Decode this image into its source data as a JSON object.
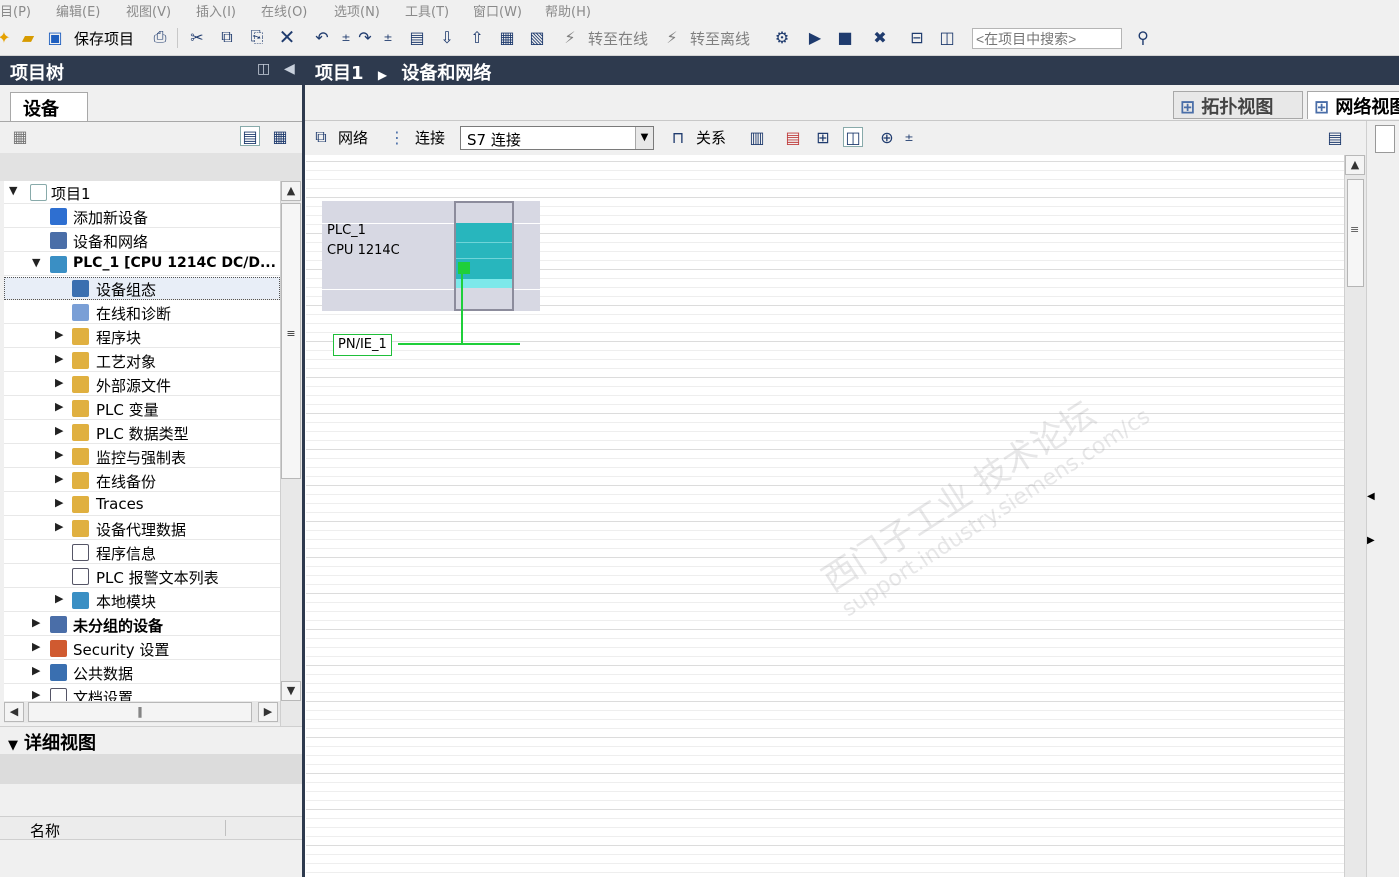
{
  "menu": [
    "目(P)",
    "编辑(E)",
    "视图(V)",
    "插入(I)",
    "在线(O)",
    "选项(N)",
    "工具(T)",
    "窗口(W)",
    "帮助(H)"
  ],
  "toolbar": {
    "save_project": "保存项目",
    "go_online": "转至在线",
    "go_offline": "转至离线",
    "search_placeholder": "<在项目中搜索>"
  },
  "project_tree": {
    "title": "项目树",
    "devices_tab": "设备",
    "items": [
      {
        "label": "项目1",
        "icon": "project-icon"
      },
      {
        "label": "添加新设备",
        "icon": "add-device-icon"
      },
      {
        "label": "设备和网络",
        "icon": "network-icon"
      },
      {
        "label": "PLC_1 [CPU 1214C DC/D...",
        "icon": "plc-icon"
      },
      {
        "label": "设备组态",
        "icon": "device-config-icon"
      },
      {
        "label": "在线和诊断",
        "icon": "diagnostics-icon"
      },
      {
        "label": "程序块",
        "icon": "program-blocks-icon"
      },
      {
        "label": "工艺对象",
        "icon": "technology-objects-icon"
      },
      {
        "label": "外部源文件",
        "icon": "external-sources-icon"
      },
      {
        "label": "PLC 变量",
        "icon": "plc-tags-icon"
      },
      {
        "label": "PLC 数据类型",
        "icon": "plc-data-types-icon"
      },
      {
        "label": "监控与强制表",
        "icon": "watch-table-icon"
      },
      {
        "label": "在线备份",
        "icon": "online-backup-icon"
      },
      {
        "label": "Traces",
        "icon": "traces-icon"
      },
      {
        "label": "设备代理数据",
        "icon": "proxy-data-icon"
      },
      {
        "label": "程序信息",
        "icon": "program-info-icon"
      },
      {
        "label": "PLC 报警文本列表",
        "icon": "alarm-text-icon"
      },
      {
        "label": "本地模块",
        "icon": "local-modules-icon"
      },
      {
        "label": "未分组的设备",
        "icon": "ungrouped-devices-icon"
      },
      {
        "label": "Security 设置",
        "icon": "security-icon"
      },
      {
        "label": "公共数据",
        "icon": "common-data-icon"
      },
      {
        "label": "文档设置",
        "icon": "document-settings-icon"
      }
    ]
  },
  "detail_view": {
    "title": "详细视图",
    "column_name": "名称"
  },
  "editor": {
    "breadcrumb_project": "项目1",
    "breadcrumb_page": "设备和网络",
    "topology_tab": "拓扑视图",
    "network_tab": "网络视图",
    "network_btn": "网络",
    "connections_btn": "连接",
    "connection_type": "S7 连接",
    "relations_btn": "关系"
  },
  "device": {
    "name": "PLC_1",
    "type": "CPU 1214C",
    "subnet": "PN/IE_1"
  },
  "watermark": {
    "line1": "西门子工业 技术论坛",
    "line2": "support.industry.siemens.com/cs"
  },
  "colors": {
    "title_bar": "#2e3a4e",
    "module_teal": "#28b6bd",
    "network_green": "#1fcf3a",
    "device_bg": "#d7d8e3"
  }
}
